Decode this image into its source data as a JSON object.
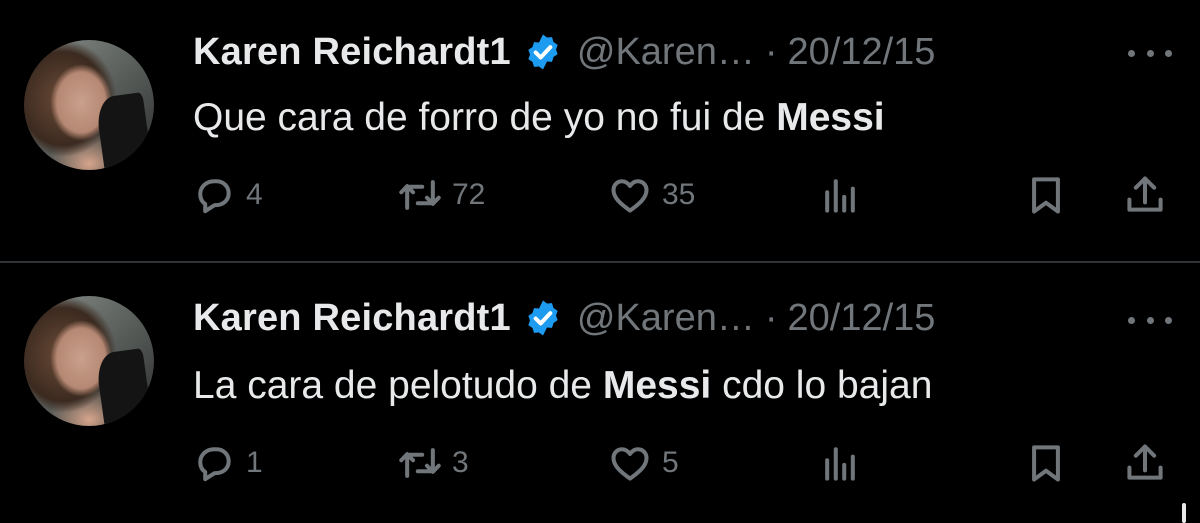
{
  "tweets": [
    {
      "author_name": "Karen Reichardt1",
      "handle": "@Karen…",
      "separator": "·",
      "date": "20/12/15",
      "text_before": "Que cara de forro de yo no fui de ",
      "text_bold": "Messi",
      "text_after": "",
      "replies": "4",
      "retweets": "72",
      "likes": "35"
    },
    {
      "author_name": "Karen Reichardt1",
      "handle": "@Karen…",
      "separator": "·",
      "date": "20/12/15",
      "text_before": "La cara de pelotudo de ",
      "text_bold": "Messi",
      "text_after": " cdo lo bajan",
      "replies": "1",
      "retweets": "3",
      "likes": "5"
    }
  ],
  "icons": {
    "verified": "verified-badge-icon",
    "more": "more-horizontal-icon",
    "reply": "reply-icon",
    "retweet": "retweet-icon",
    "like": "heart-icon",
    "views": "views-icon",
    "bookmark": "bookmark-icon",
    "share": "share-icon"
  },
  "colors": {
    "background": "#000000",
    "text": "#e7e9ea",
    "secondary": "#71767b",
    "verified": "#1d9bf0",
    "divider": "#2f3336"
  }
}
